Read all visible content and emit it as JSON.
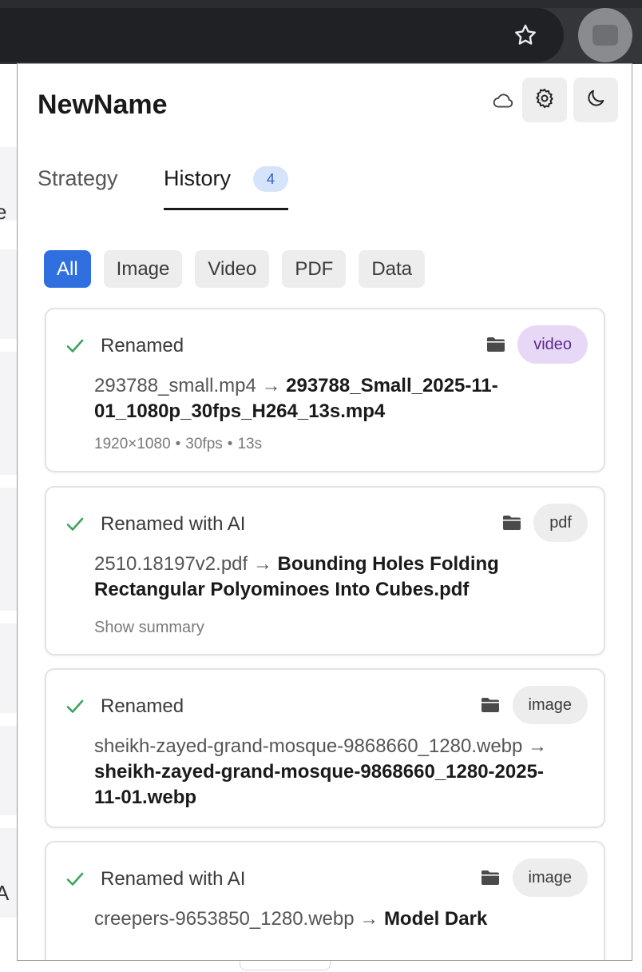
{
  "app": {
    "title": "NewName"
  },
  "tabs": [
    {
      "label": "Strategy",
      "active": false
    },
    {
      "label": "History",
      "active": true,
      "count": "4"
    }
  ],
  "filters": [
    "All",
    "Image",
    "Video",
    "PDF",
    "Data"
  ],
  "active_filter": "All",
  "history": [
    {
      "status": "Renamed",
      "type": "video",
      "from": "293788_small.mp4",
      "to": "293788_Small_2025-11-01_1080p_30fps_H264_13s.mp4",
      "meta": [
        "1920×1080",
        "30fps",
        "13s"
      ]
    },
    {
      "status": "Renamed with AI",
      "type": "pdf",
      "from": "2510.18197v2.pdf",
      "to": "Bounding Holes Folding Rectangular Polyominoes Into Cubes.pdf",
      "summary_link": "Show summary"
    },
    {
      "status": "Renamed",
      "type": "image",
      "from": "sheikh-zayed-grand-mosque-9868660_1280.webp",
      "to": "sheikh-zayed-grand-mosque-9868660_1280-2025-11-01.webp"
    },
    {
      "status": "Renamed with AI",
      "type": "image",
      "from": "creepers-9653850_1280.webp",
      "to": "Model Dark"
    }
  ],
  "arrow": "→",
  "colors": {
    "accent": "#2f6fe0",
    "success": "#3aa55d",
    "video_badge_bg": "#e7d9f6",
    "video_badge_text": "#5b2a8e",
    "count_badge_bg": "#d5e3fb"
  },
  "icons": {
    "bookmark": "star-icon",
    "extension": "extension-icon",
    "sync": "cloud-icon",
    "settings": "gear-icon",
    "theme": "moon-icon",
    "success": "check-icon",
    "open": "folder-icon"
  }
}
